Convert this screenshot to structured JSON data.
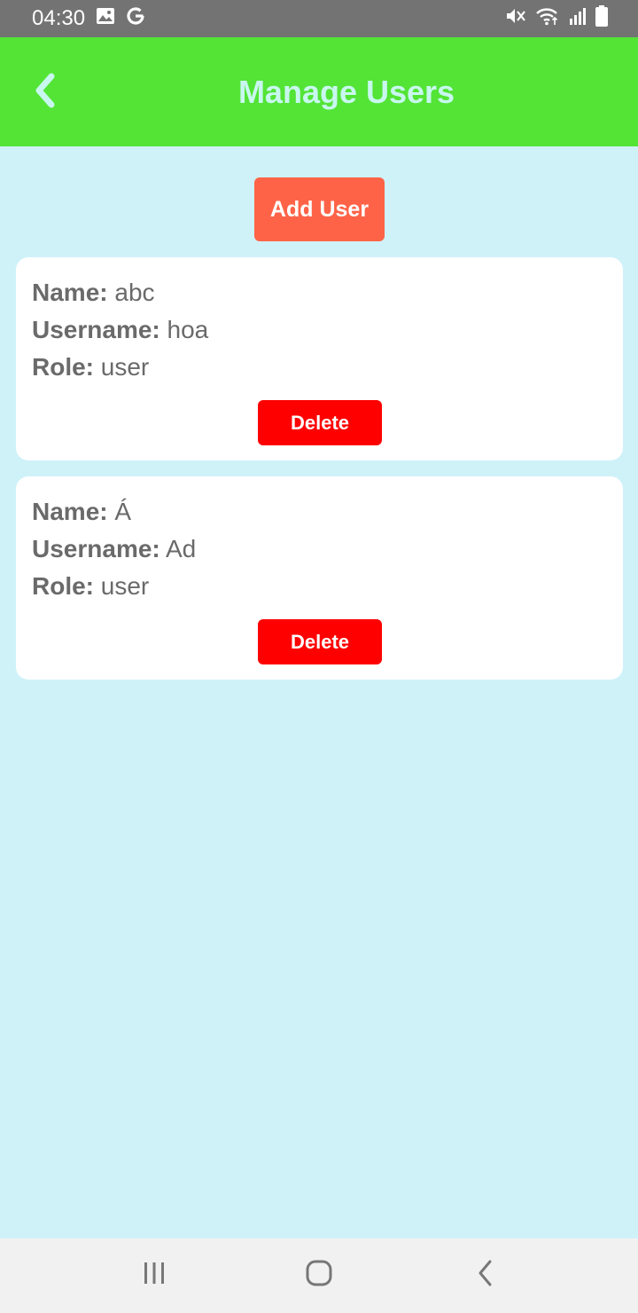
{
  "status_bar": {
    "time": "04:30",
    "left_icons": [
      "image-icon",
      "google-icon"
    ],
    "right_icons": [
      "mute-icon",
      "wifi-icon",
      "signal-icon",
      "battery-icon"
    ]
  },
  "header": {
    "title": "Manage Users",
    "back_icon": "chevron-left-icon",
    "background": "#53e436",
    "title_color": "#c8f7ef"
  },
  "actions": {
    "add_user_label": "Add User",
    "add_user_color": "#ff6347"
  },
  "users": [
    {
      "name_label": "Name:",
      "name": "abc",
      "username_label": "Username:",
      "username": "hoa",
      "role_label": "Role:",
      "role": "user",
      "delete_label": "Delete"
    },
    {
      "name_label": "Name:",
      "name": "Á",
      "username_label": "Username:",
      "username": "Ad",
      "role_label": "Role:",
      "role": "user",
      "delete_label": "Delete"
    }
  ],
  "colors": {
    "page_background": "#cff2f9",
    "delete_button": "#ff0000"
  },
  "nav_bar": {
    "icons": [
      "recent-apps-icon",
      "home-icon",
      "back-icon"
    ]
  }
}
